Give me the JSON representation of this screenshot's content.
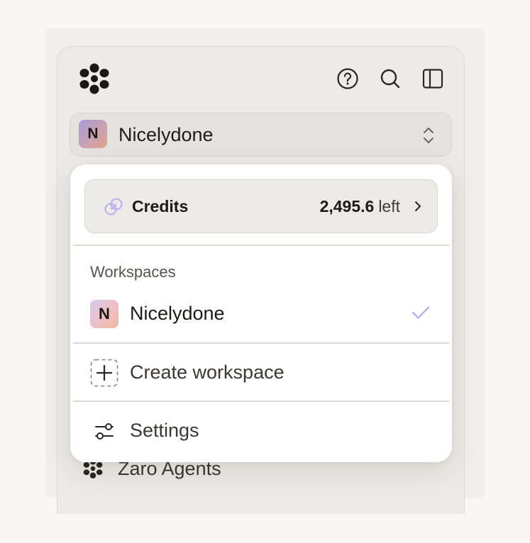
{
  "workspace_switcher": {
    "initial": "N",
    "name": "Nicelydone"
  },
  "toolbar": {
    "icons": [
      "help-icon",
      "search-icon",
      "sidebar-toggle-icon"
    ]
  },
  "dropdown": {
    "credits": {
      "label": "Credits",
      "amount": "2,495.6",
      "suffix": "left"
    },
    "workspaces_title": "Workspaces",
    "workspaces": [
      {
        "initial": "N",
        "name": "Nicelydone",
        "selected": true
      }
    ],
    "create_label": "Create workspace",
    "settings_label": "Settings"
  },
  "sidebar": {
    "bottom_item_label": "Zaro Agents"
  },
  "colors": {
    "accent_check": "#b8b0ec",
    "credits_icon": "#b6aef0",
    "sidebar_bg": "#ecebe7",
    "dropdown_bg": "#ffffff"
  }
}
